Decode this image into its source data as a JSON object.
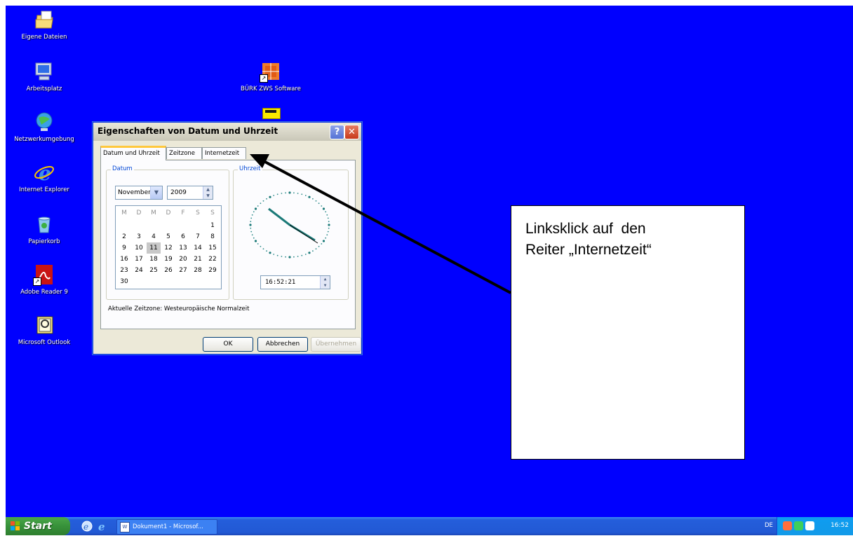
{
  "desktop": {
    "background": "#0000fe",
    "icons": [
      {
        "label": "Eigene Dateien",
        "icon": "my-documents-folder-icon"
      },
      {
        "label": "Arbeitsplatz",
        "icon": "my-computer-icon"
      },
      {
        "label": "Netzwerkumgebung",
        "icon": "network-icon"
      },
      {
        "label": "Internet Explorer",
        "icon": "internet-explorer-icon"
      },
      {
        "label": "Papierkorb",
        "icon": "recycle-bin-icon"
      },
      {
        "label": "Adobe Reader 9",
        "icon": "adobe-reader-icon"
      },
      {
        "label": "Microsoft Outlook",
        "icon": "outlook-icon"
      },
      {
        "label": "BÜRK ZWS Software",
        "icon": "buerk-zws-icon"
      }
    ]
  },
  "dialog": {
    "title": "Eigenschaften von Datum und Uhrzeit",
    "tabs": [
      "Datum und Uhrzeit",
      "Zeitzone",
      "Internetzeit"
    ],
    "active_tab": "Datum und Uhrzeit",
    "date_group": {
      "legend": "Datum",
      "month": "November",
      "year": "2009",
      "weekday_headers": [
        "M",
        "D",
        "M",
        "D",
        "F",
        "S",
        "S"
      ],
      "weeks": [
        [
          "",
          "",
          "",
          "",
          "",
          "",
          "1"
        ],
        [
          "2",
          "3",
          "4",
          "5",
          "6",
          "7",
          "8"
        ],
        [
          "9",
          "10",
          "11",
          "12",
          "13",
          "14",
          "15"
        ],
        [
          "16",
          "17",
          "18",
          "19",
          "20",
          "21",
          "22"
        ],
        [
          "23",
          "24",
          "25",
          "26",
          "27",
          "28",
          "29"
        ],
        [
          "30",
          "",
          "",
          "",
          "",
          "",
          ""
        ]
      ],
      "selected_day": "11"
    },
    "time_group": {
      "legend": "Uhrzeit",
      "time": "16:52:21"
    },
    "timezone_text": "Aktuelle Zeitzone: Westeuropäische Normalzeit",
    "buttons": {
      "ok": "OK",
      "cancel": "Abbrechen",
      "apply": "Übernehmen"
    },
    "help_glyph": "?",
    "close_glyph": "✕"
  },
  "annotation": {
    "text": "Linksklick auf  den\nReiter „Internetzeit“"
  },
  "taskbar": {
    "start_label": "Start",
    "task_item": "Dokument1 - Microsof...",
    "language": "DE",
    "clock": "16:52",
    "accent": "#245edb"
  }
}
